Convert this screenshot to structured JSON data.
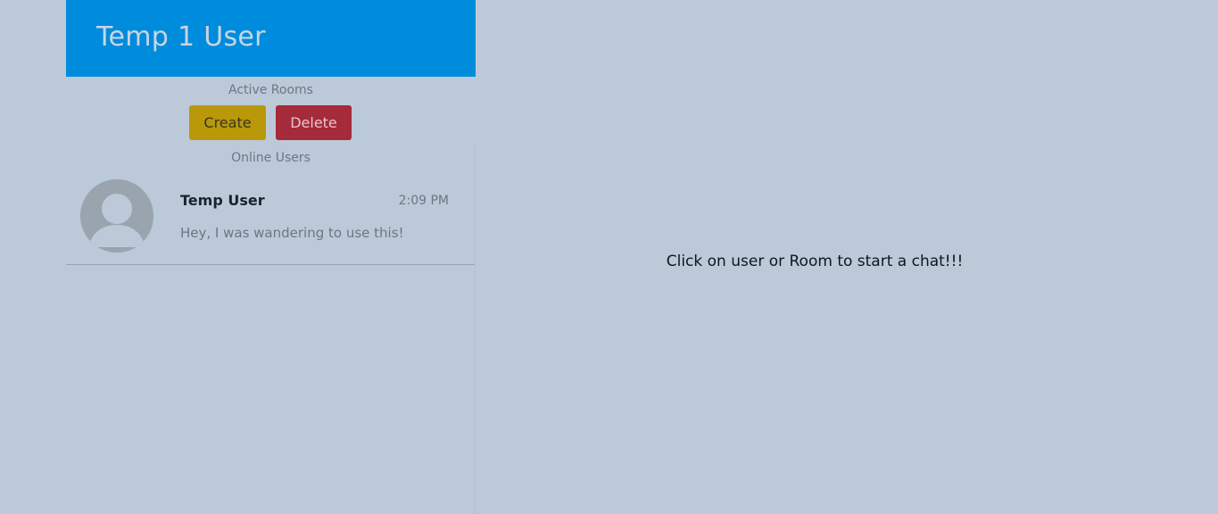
{
  "header": {
    "title": "Temp 1 User"
  },
  "rooms": {
    "label": "Active Rooms",
    "create_label": "Create",
    "delete_label": "Delete"
  },
  "users": {
    "label": "Online Users",
    "items": [
      {
        "name": "Temp User",
        "time": "2:09 PM",
        "message": "Hey, I was wandering to use this!",
        "avatar_icon": "user-avatar-icon"
      }
    ]
  },
  "main": {
    "prompt": "Click on user or Room to start a chat!!!"
  },
  "colors": {
    "background": "#bcc9d8",
    "header": "#008cdc",
    "create_button": "#b9980a",
    "delete_button": "#a52a3a"
  }
}
